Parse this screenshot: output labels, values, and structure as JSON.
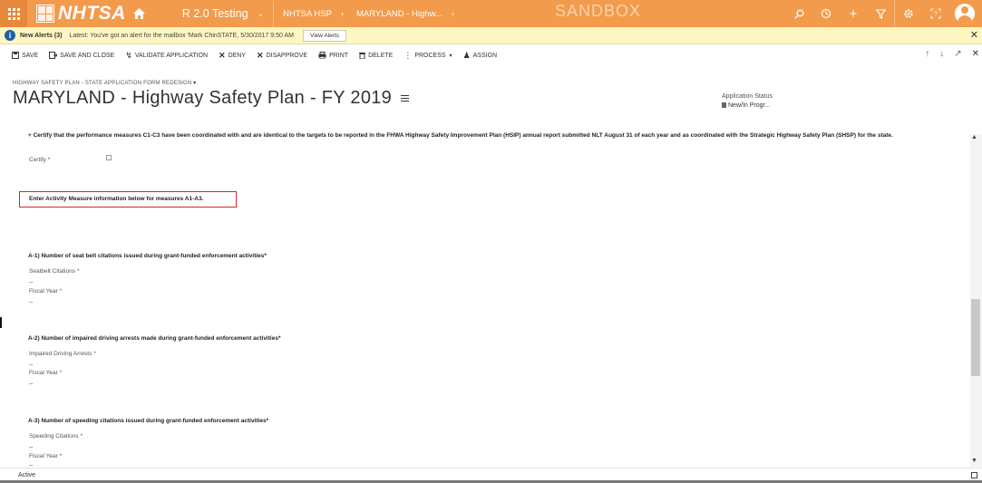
{
  "nav": {
    "logo_text": "NHTSA",
    "app_name": "R 2.0 Testing",
    "area": "NHTSA HSP",
    "record_crumb": "MARYLAND - Highw...",
    "environment": "SANDBOX",
    "brand_color": "#f29b4c"
  },
  "alert": {
    "title": "New Alerts (3)",
    "message": "Latest: You've got an alert for the mailbox 'Mark ChinSTATE, 5/30/2017 9:50 AM",
    "button": "View Alerts"
  },
  "commands": {
    "save": "SAVE",
    "save_close": "SAVE AND CLOSE",
    "validate": "VALIDATE APPLICATION",
    "deny": "DENY",
    "disapprove": "DISAPPROVE",
    "print": "PRINT",
    "delete": "DELETE",
    "process": "PROCESS",
    "assign": "ASSIGN"
  },
  "header": {
    "form_selector": "HIGHWAY SAFETY PLAN - STATE APPLICATION FORM REDESIGN",
    "title": "MARYLAND - Highway Safety Plan - FY 2019",
    "status_label": "Application Status",
    "status_value": "New/In Progr..."
  },
  "form": {
    "certify_text": "+ Certify that the performance measures C1-C3 have been coordinated with and are identical to the targets to be reported in the FHWA Highway Safety Improvement Plan (HSIP) annual report submitted NLT August 31 of each year and as coordinated with the Strategic Highway Safety Plan (SHSP) for the state.",
    "certify_label": "Certify",
    "activity_note": "Enter Activity Measure information below for measures A1-A3.",
    "required_mark": "*",
    "sections": [
      {
        "title": "A-1) Number of seat belt citations issued during grant-funded enforcement activities*",
        "field1_label": "Seatbelt Citations",
        "field1_value": "--",
        "field2_label": "Fiscal Year",
        "field2_value": "--"
      },
      {
        "title": "A-2) Number of impaired driving arrests made during grant-funded enforcement activities*",
        "field1_label": "Impaired Driving Arrests",
        "field1_value": "--",
        "field2_label": "Fiscal Year",
        "field2_value": "--"
      },
      {
        "title": "A-3) Number of speeding citations issued during grant-funded enforcement activities*",
        "field1_label": "Speeding Citations",
        "field1_value": "--",
        "field2_label": "Fiscal Year",
        "field2_value": "--"
      }
    ]
  },
  "footer": {
    "status": "Active"
  }
}
